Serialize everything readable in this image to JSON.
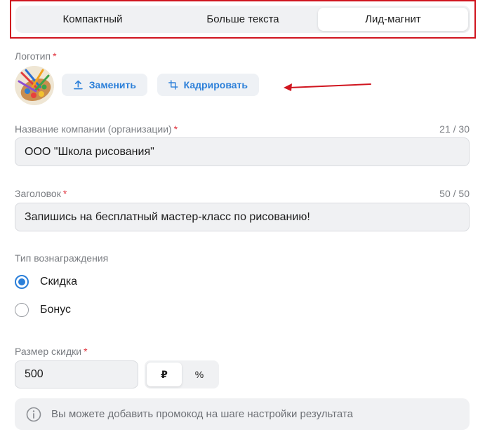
{
  "tabs": [
    {
      "label": "Компактный",
      "active": false
    },
    {
      "label": "Больше текста",
      "active": false
    },
    {
      "label": "Лид-магнит",
      "active": true
    }
  ],
  "logo": {
    "label": "Логотип",
    "replace_label": "Заменить",
    "crop_label": "Кадрировать"
  },
  "company": {
    "label": "Название компании (организации)",
    "counter": "21 / 30",
    "value": "ООО \"Школа рисования\""
  },
  "heading": {
    "label": "Заголовок",
    "counter": "50 / 50",
    "value": "Запишись на бесплатный мастер-класс по рисованию!"
  },
  "reward": {
    "label": "Тип вознаграждения",
    "options": [
      {
        "label": "Скидка",
        "checked": true
      },
      {
        "label": "Бонус",
        "checked": false
      }
    ]
  },
  "discount": {
    "label": "Размер скидки",
    "value": "500",
    "units": [
      {
        "label": "₽",
        "active": true
      },
      {
        "label": "%",
        "active": false
      }
    ]
  },
  "info": {
    "text": "Вы можете добавить промокод на шаге настройки результата"
  },
  "colors": {
    "accent": "#2b7fd9",
    "required": "#e0303b",
    "annotation": "#d0151f"
  }
}
